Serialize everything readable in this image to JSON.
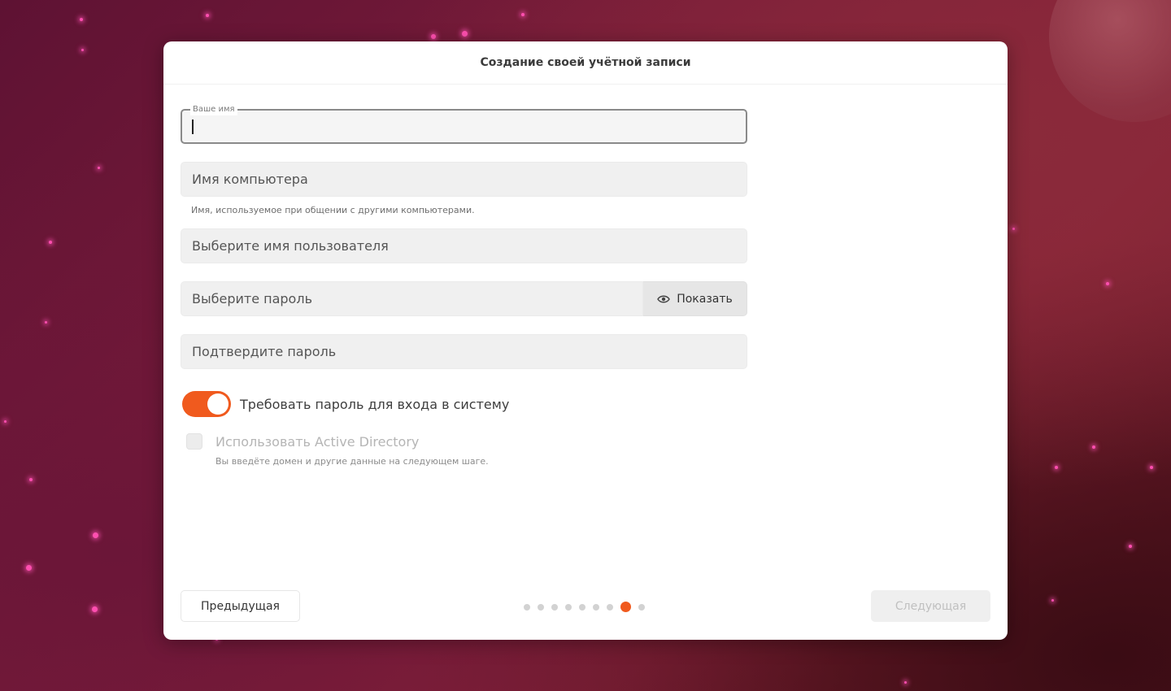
{
  "dialog": {
    "title": "Создание своей учётной записи"
  },
  "form": {
    "name_field": {
      "label": "Ваше имя",
      "value": ""
    },
    "computer_field": {
      "placeholder": "Имя компьютера",
      "hint": "Имя, используемое при общении с другими компьютерами."
    },
    "username_field": {
      "placeholder": "Выберите имя пользователя"
    },
    "password_field": {
      "placeholder": "Выберите пароль",
      "show_label": "Показать",
      "show_icon": "eye-icon"
    },
    "confirm_field": {
      "placeholder": "Подтвердите пароль"
    },
    "require_password": {
      "label": "Требовать пароль для входа в систему",
      "enabled": true
    },
    "active_directory": {
      "label": "Использовать Active Directory",
      "hint": "Вы введёте домен и другие данные на следующем шаге.",
      "checked": false,
      "disabled": true
    }
  },
  "footer": {
    "prev_label": "Предыдущая",
    "next_label": "Следующая",
    "steps_total": 9,
    "current_step": 8
  },
  "colors": {
    "accent": "#f05a1e",
    "background": "#7a1c3a"
  }
}
